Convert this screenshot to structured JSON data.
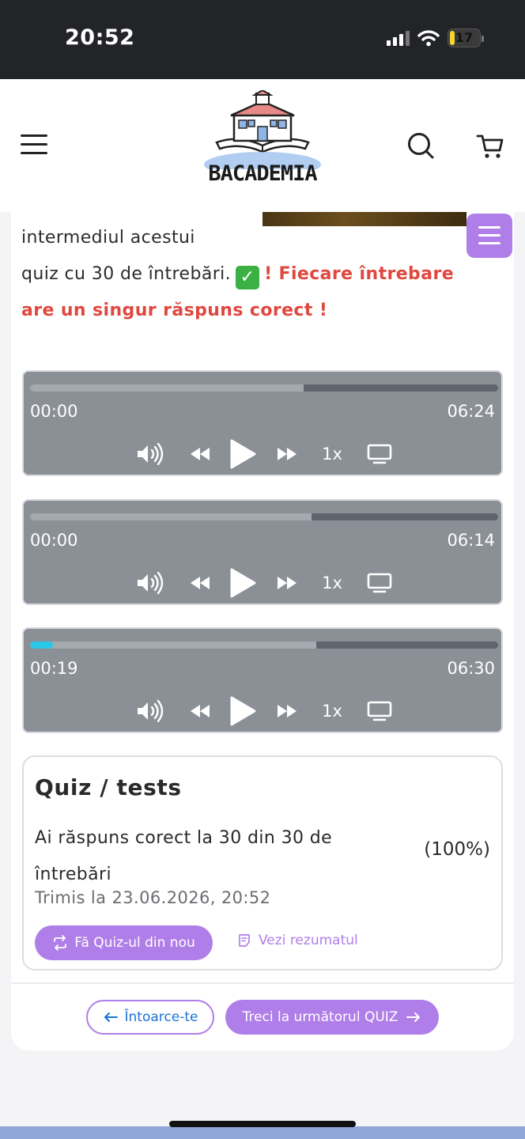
{
  "status_bar": {
    "time": "20:52",
    "battery": "17",
    "battery_level": 0.17
  },
  "header": {
    "logo_text": "BACADEMIA"
  },
  "intro": {
    "line1": "intermediul acestui",
    "line2_prefix": "quiz cu 30 de întrebări.",
    "check_icon": "check-mark-icon",
    "line2_warning": "! Fiecare întrebare",
    "line3_warning": "are un singur răspuns corect !"
  },
  "players": [
    {
      "current": "00:00",
      "duration": "06:24",
      "speed": "1x",
      "buffered": 0.585,
      "played": 0
    },
    {
      "current": "00:00",
      "duration": "06:14",
      "speed": "1x",
      "buffered": 0.602,
      "played": 0
    },
    {
      "current": "00:19",
      "duration": "06:30",
      "speed": "1x",
      "buffered": 0.612,
      "played": 0.049
    }
  ],
  "quiz": {
    "title": "Quiz / tests",
    "result": "Ai răspuns corect la 30 din 30 de întrebări",
    "percent": "(100%)",
    "sent": "Trimis la 23.06.2026, 20:52",
    "retry_label": "Fă Quiz-ul din nou",
    "summary_label": "Vezi rezumatul"
  },
  "nav": {
    "back_label": "Întoarce-te",
    "next_label": "Treci la următorul QUIZ"
  },
  "colors": {
    "accent": "#b07ee8",
    "warning": "#e0483f",
    "player_bg": "#8b9097",
    "progress": "#29c7e8",
    "link_blue": "#1b73d6"
  }
}
